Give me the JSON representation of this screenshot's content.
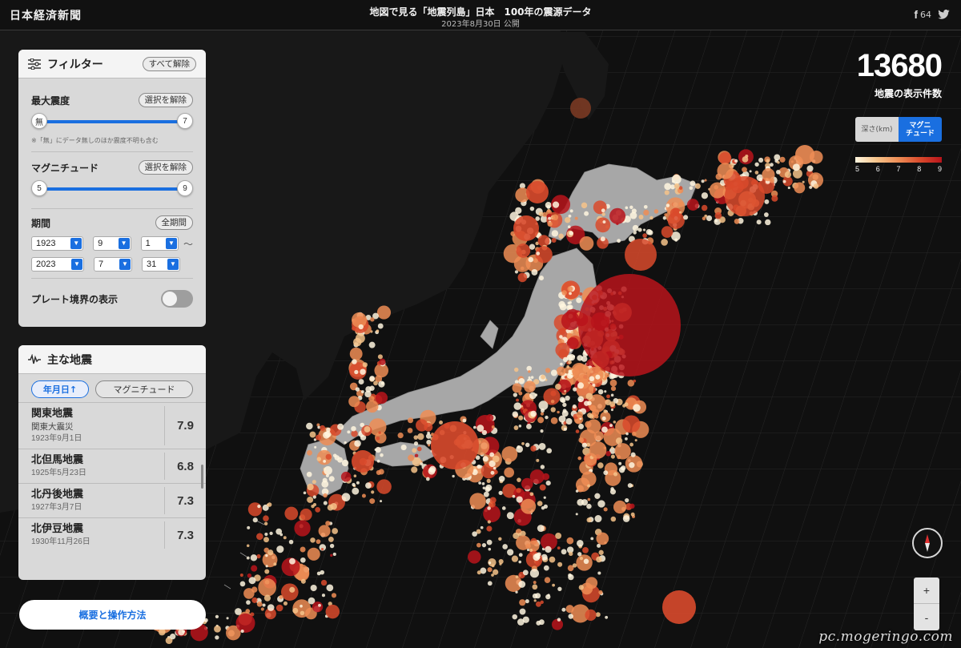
{
  "header": {
    "logo": "日本経済新聞",
    "title": "地図で見る「地震列島」日本　100年の震源データ",
    "published": "2023年8月30日 公開",
    "share_count": "64"
  },
  "filter": {
    "title": "フィルター",
    "reset_all": "すべて解除",
    "max_intensity": {
      "label": "最大震度",
      "clear": "選択を解除",
      "min": "無",
      "max": "7",
      "note": "※「無」にデータ無しのほか震度不明も含む"
    },
    "magnitude": {
      "label": "マグニチュード",
      "clear": "選択を解除",
      "min": "5",
      "max": "9"
    },
    "period": {
      "label": "期間",
      "all": "全期間",
      "from": {
        "year": "1923",
        "month": "9",
        "day": "1"
      },
      "to": {
        "year": "2023",
        "month": "7",
        "day": "31"
      },
      "separator": "〜"
    },
    "plate_boundary": {
      "label": "プレート境界の表示",
      "enabled": false
    }
  },
  "quakes": {
    "title": "主な地震",
    "sort_date": "年月日↑",
    "sort_magnitude": "マグニチュード",
    "items": [
      {
        "name": "関東地震",
        "sub": "関東大震災",
        "date": "1923年9月1日",
        "mag": "7.9"
      },
      {
        "name": "北但馬地震",
        "sub": "",
        "date": "1925年5月23日",
        "mag": "6.8"
      },
      {
        "name": "北丹後地震",
        "sub": "",
        "date": "1927年3月7日",
        "mag": "7.3"
      },
      {
        "name": "北伊豆地震",
        "sub": "",
        "date": "1930年11月26日",
        "mag": "7.3"
      }
    ]
  },
  "overview_button": "概要と操作方法",
  "stats": {
    "count": "13680",
    "count_label": "地震の表示件数"
  },
  "mode": {
    "depth": "深さ(km)",
    "magnitude_line1": "マグニ",
    "magnitude_line2": "チュード",
    "active": "magnitude"
  },
  "legend": {
    "ticks": [
      "5",
      "6",
      "7",
      "8",
      "9"
    ],
    "colors": [
      "#fff6df",
      "#f6c38a",
      "#ee8d55",
      "#d94a2c",
      "#b8141b"
    ]
  },
  "zoom": {
    "in": "+",
    "out": "-"
  },
  "icons": {
    "filter": "sliders-icon",
    "quakes": "waveform-icon",
    "share_facebook": "facebook-icon",
    "share_twitter": "twitter-icon",
    "compass": "compass-icon"
  },
  "watermark": "pc.mogeringo.com"
}
